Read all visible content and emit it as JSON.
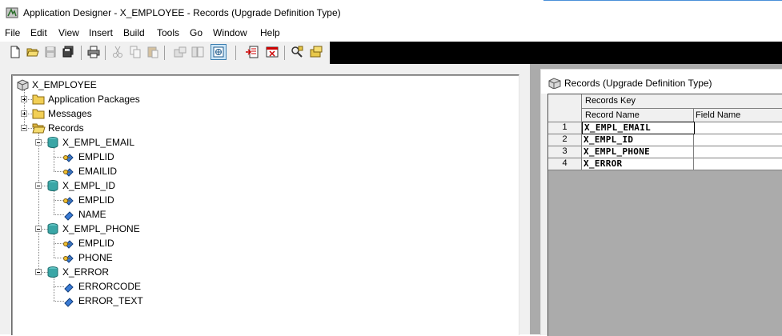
{
  "window": {
    "title": "Application Designer - X_EMPLOYEE - Records (Upgrade Definition Type)"
  },
  "menu": [
    "File",
    "Edit",
    "View",
    "Insert",
    "Build",
    "Tools",
    "Go",
    "Window",
    "Help"
  ],
  "toolbar": {
    "icons": [
      "new-icon",
      "open-icon",
      "save-icon",
      "save-all-icon",
      "print-icon",
      "cut-icon",
      "copy-icon",
      "paste-icon",
      "find-definition-icon",
      "project-workspace-icon",
      "insert-into-project-icon",
      "build-project-icon",
      "find-in-icon",
      "validate-project-icon"
    ]
  },
  "tree": {
    "root": "X_EMPLOYEE",
    "nodes": [
      {
        "label": "Application Packages",
        "type": "folder",
        "expander": "plus"
      },
      {
        "label": "Messages",
        "type": "folder",
        "expander": "plus"
      },
      {
        "label": "Records",
        "type": "folder-open",
        "expander": "minus"
      },
      {
        "label": "X_EMPL_EMAIL",
        "type": "record"
      },
      {
        "label": "EMPLID",
        "type": "key-field"
      },
      {
        "label": "EMAILID",
        "type": "key-field"
      },
      {
        "label": "X_EMPL_ID",
        "type": "record"
      },
      {
        "label": "EMPLID",
        "type": "key-field"
      },
      {
        "label": "NAME",
        "type": "field"
      },
      {
        "label": "X_EMPL_PHONE",
        "type": "record"
      },
      {
        "label": "EMPLID",
        "type": "key-field"
      },
      {
        "label": "PHONE",
        "type": "key-field"
      },
      {
        "label": "X_ERROR",
        "type": "record"
      },
      {
        "label": "ERRORCODE",
        "type": "field"
      },
      {
        "label": "ERROR_TEXT",
        "type": "field"
      }
    ]
  },
  "records_window": {
    "title": "Records (Upgrade Definition Type)",
    "header_group": "Records Key",
    "columns": [
      "Record Name",
      "Field Name"
    ],
    "rows": [
      {
        "num": "1",
        "record": "X_EMPL_EMAIL",
        "field": ""
      },
      {
        "num": "2",
        "record": "X_EMPL_ID",
        "field": ""
      },
      {
        "num": "3",
        "record": "X_EMPL_PHONE",
        "field": ""
      },
      {
        "num": "4",
        "record": "X_ERROR",
        "field": ""
      }
    ]
  }
}
